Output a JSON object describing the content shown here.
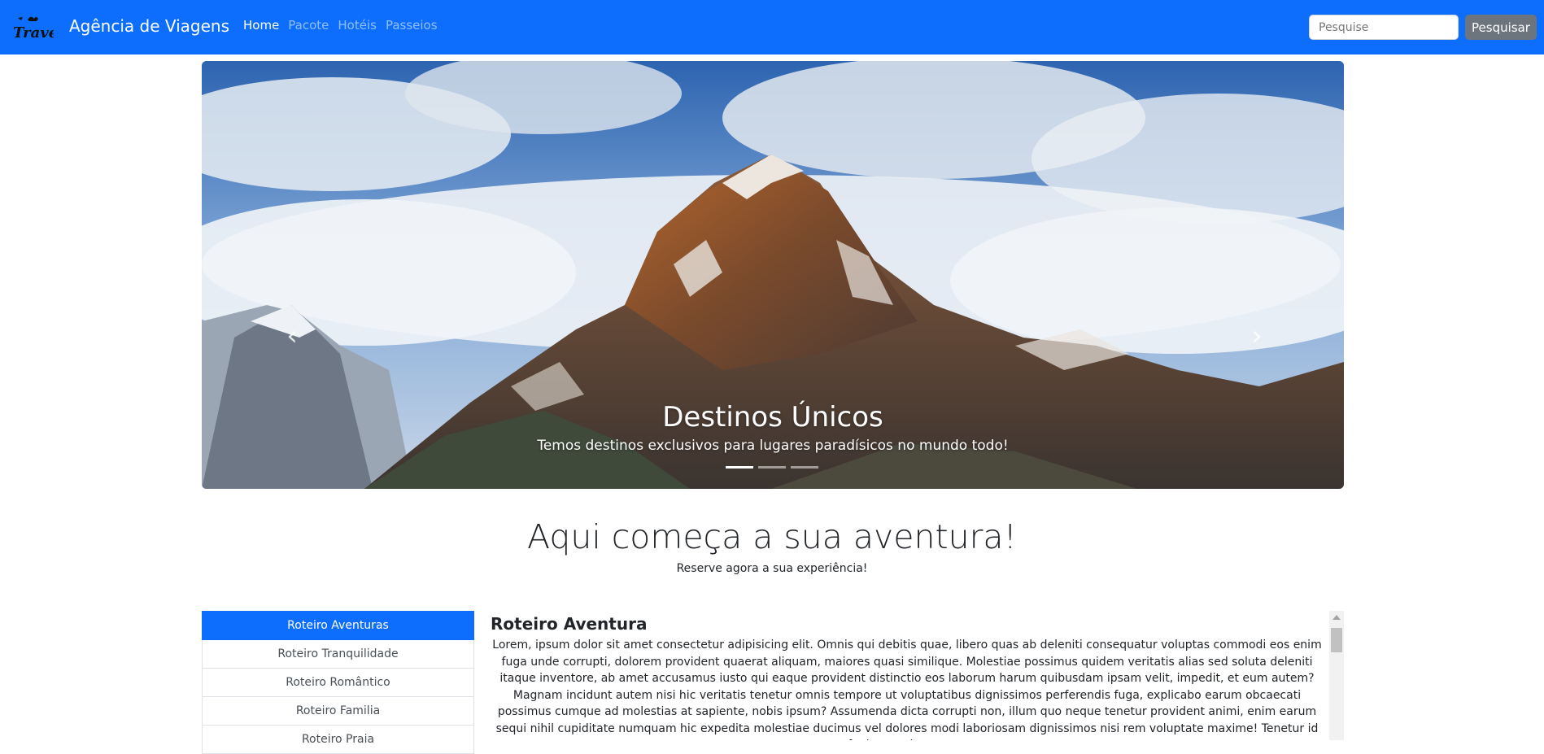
{
  "navbar": {
    "logo_text": "Travel",
    "brand": "Agência de Viagens",
    "links": [
      {
        "label": "Home",
        "active": true
      },
      {
        "label": "Pacote",
        "active": false
      },
      {
        "label": "Hotéis",
        "active": false
      },
      {
        "label": "Passeios",
        "active": false
      }
    ],
    "search_placeholder": "Pesquise",
    "search_button": "Pesquisar",
    "colors": {
      "navbar_bg": "#0d6efd",
      "button_bg": "#6c757d"
    }
  },
  "carousel": {
    "prev_icon": "chevron-left-icon",
    "next_icon": "chevron-right-icon",
    "prev_glyph": "‹",
    "next_glyph": "›",
    "caption_title": "Destinos Únicos",
    "caption_text": "Temos destinos exclusivos para lugares paradísicos no mundo todo!",
    "slide_count": 3,
    "active_slide": 1
  },
  "intro": {
    "headline": "Aqui começa a sua aventura!",
    "subline": "Reserve agora a sua experiência!"
  },
  "itineraries": {
    "items": [
      {
        "label": "Roteiro Aventuras",
        "active": true
      },
      {
        "label": "Roteiro Tranquilidade",
        "active": false
      },
      {
        "label": "Roteiro Romântico",
        "active": false
      },
      {
        "label": "Roteiro Familia",
        "active": false
      },
      {
        "label": "Roteiro Praia",
        "active": false
      }
    ]
  },
  "details": {
    "title": "Roteiro Aventura",
    "text": "Lorem, ipsum dolor sit amet consectetur adipisicing elit. Omnis qui debitis quae, libero quas ab deleniti consequatur voluptas commodi eos enim fuga unde corrupti, dolorem provident quaerat aliquam, maiores quasi similique. Molestiae possimus quidem veritatis alias sed soluta deleniti itaque inventore, ab amet accusamus iusto qui eaque provident distinctio eos laborum harum quibusdam ipsam velit, impedit, et eum autem? Magnam incidunt autem nisi hic veritatis tenetur omnis tempore ut voluptatibus dignissimos perferendis fuga, explicabo earum obcaecati possimus cumque ad molestias at sapiente, nobis ipsum? Assumenda dicta corrupti non, illum quo neque tenetur provident animi, enim earum sequi nihil cupiditate numquam hic expedita molestiae ducimus vel dolores modi laboriosam dignissimos nisi rem voluptate maxime! Tenetur id fugit magni aut quos"
  }
}
